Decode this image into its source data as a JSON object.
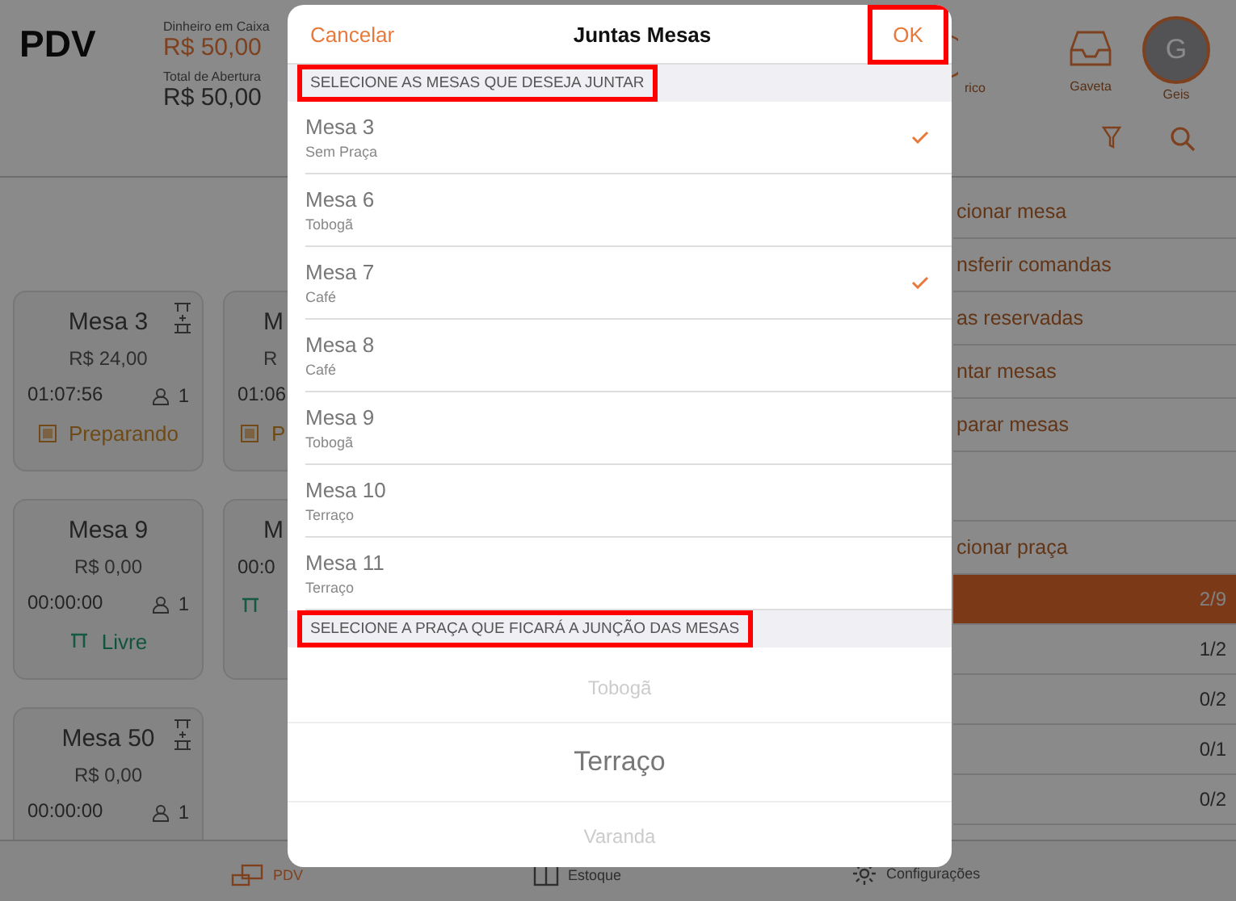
{
  "app": {
    "title": "PDV",
    "cash_label": "Dinheiro em Caixa",
    "cash_value": "R$ 50,00",
    "opening_label": "Total de Abertura",
    "opening_value": "R$ 50,00",
    "toolbar": [
      {
        "kind": "history",
        "label": "rico"
      },
      {
        "kind": "drawer",
        "label": "Gaveta"
      },
      {
        "kind": "avatar",
        "initial": "G",
        "label": "Geis"
      }
    ],
    "cards": [
      {
        "title": "Mesa 3",
        "price": "R$ 24,00",
        "time": "01:07:56",
        "people": "1",
        "status": "Preparando",
        "kind": "preparing",
        "joined": true
      },
      {
        "title": "M",
        "price": "R",
        "time": "01:06",
        "status": "P",
        "kind": "preparing",
        "joined": false
      },
      {
        "title": "Mesa 9",
        "price": "R$ 0,00",
        "time": "00:00:00",
        "people": "1",
        "status": "Livre",
        "kind": "free",
        "joined": false
      },
      {
        "title": "M",
        "time": "00:0",
        "kind": "free",
        "joined": false
      },
      {
        "title": "Mesa 50",
        "price": "R$ 0,00",
        "time": "00:00:00",
        "people": "1",
        "joined": true
      }
    ],
    "menu": [
      "cionar mesa",
      "nsferir comandas",
      "as reservadas",
      "ntar mesas",
      "parar mesas"
    ],
    "area_title": "cionar praça",
    "areas": [
      {
        "count": "2/9",
        "selected": true
      },
      {
        "count": "1/2",
        "selected": false
      },
      {
        "count": "0/2",
        "selected": false
      },
      {
        "count": "0/1",
        "selected": false
      },
      {
        "count": "0/2",
        "selected": false
      }
    ],
    "tabbar": [
      {
        "kind": "pdv",
        "label": "PDV",
        "selected": true
      },
      {
        "kind": "stock",
        "label": "Estoque",
        "selected": false
      },
      {
        "kind": "settings",
        "label": "Configurações",
        "selected": false
      }
    ]
  },
  "modal": {
    "cancel": "Cancelar",
    "title": "Juntas Mesas",
    "ok": "OK",
    "ok_highlighted": true,
    "tables_header": {
      "text": "SELECIONE AS MESAS QUE DESEJA JUNTAR",
      "highlighted": true
    },
    "tables": [
      {
        "name": "Mesa 3",
        "area": "Sem Praça",
        "selected": true
      },
      {
        "name": "Mesa 6",
        "area": "Tobogã",
        "selected": false
      },
      {
        "name": "Mesa 7",
        "area": "Café",
        "selected": true
      },
      {
        "name": "Mesa 8",
        "area": "Café",
        "selected": false
      },
      {
        "name": "Mesa 9",
        "area": "Tobogã",
        "selected": false
      },
      {
        "name": "Mesa 10",
        "area": "Terraço",
        "selected": false
      },
      {
        "name": "Mesa 11",
        "area": "Terraço",
        "selected": false
      }
    ],
    "area_header": {
      "text": "SELECIONE A PRAÇA QUE FICARÁ A JUNÇÃO DAS MESAS",
      "highlighted": true
    },
    "picker": [
      {
        "label": "Tobogã",
        "selected": false
      },
      {
        "label": "Terraço",
        "selected": true
      },
      {
        "label": "Varanda",
        "selected": false
      }
    ]
  }
}
